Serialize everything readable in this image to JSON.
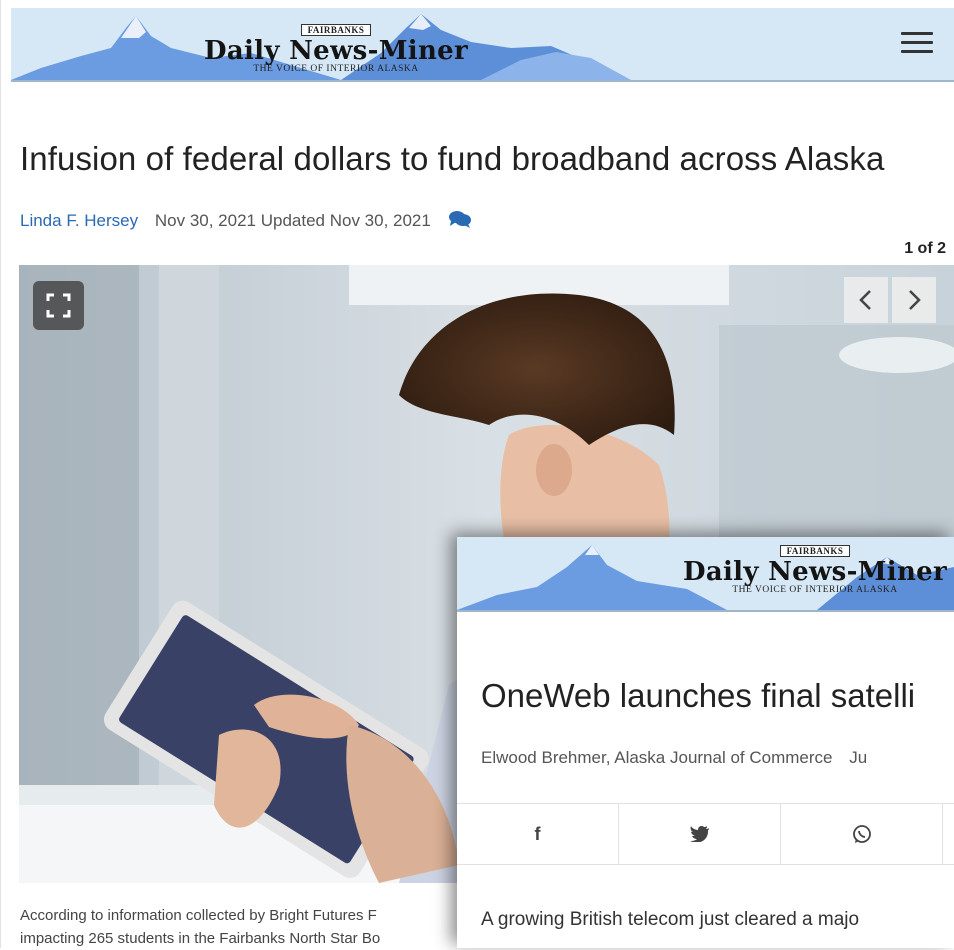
{
  "site": {
    "city_label": "FAIRBANKS",
    "name": "Daily News-Miner",
    "tagline": "THE VOICE OF INTERIOR ALASKA"
  },
  "article": {
    "headline": "Infusion of federal dollars to fund broadband across Alaska",
    "author": "Linda F. Hersey",
    "dates": "Nov 30, 2021 Updated Nov 30, 2021",
    "gallery_counter": "1 of 2",
    "caption_line1": "According to information collected by Bright Futures F",
    "caption_line2": "impacting 265 students in the Fairbanks North Star Bo"
  },
  "overlay_article": {
    "headline": "OneWeb launches final satelli",
    "byline": "Elwood Brehmer, Alaska Journal of Commerce",
    "date_fragment": "Ju",
    "share": {
      "facebook_label": "f",
      "twitter_icon": "twitter-icon",
      "whatsapp_icon": "whatsapp-icon"
    },
    "body_start": "A growing British telecom just cleared a majo"
  },
  "icons": {
    "menu": "hamburger-icon",
    "comments": "comment-icon",
    "expand": "expand-icon",
    "prev": "chevron-left-icon",
    "next": "chevron-right-icon"
  },
  "colors": {
    "masthead_bg": "#d6e8f5",
    "link": "#2a6ab3",
    "mountain": "#5d8fd9"
  }
}
